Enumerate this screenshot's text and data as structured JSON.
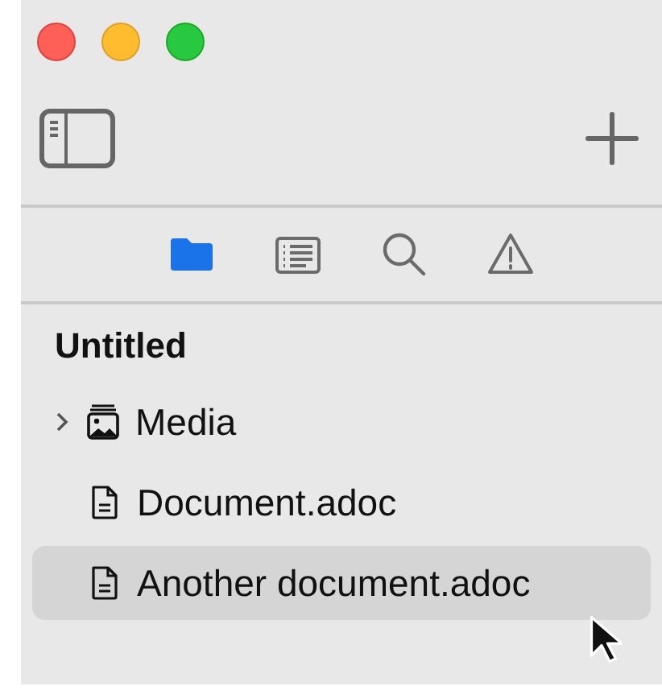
{
  "tabs": [
    {
      "kind": "files",
      "selected": true
    },
    {
      "kind": "outline",
      "selected": false
    },
    {
      "kind": "search",
      "selected": false
    },
    {
      "kind": "issues",
      "selected": false
    }
  ],
  "project": {
    "title": "Untitled"
  },
  "tree": [
    {
      "kind": "media",
      "label": "Media",
      "expanded": false,
      "selected": false
    },
    {
      "kind": "file",
      "label": "Document.adoc",
      "selected": false
    },
    {
      "kind": "file",
      "label": "Another document.adoc",
      "selected": true
    }
  ]
}
